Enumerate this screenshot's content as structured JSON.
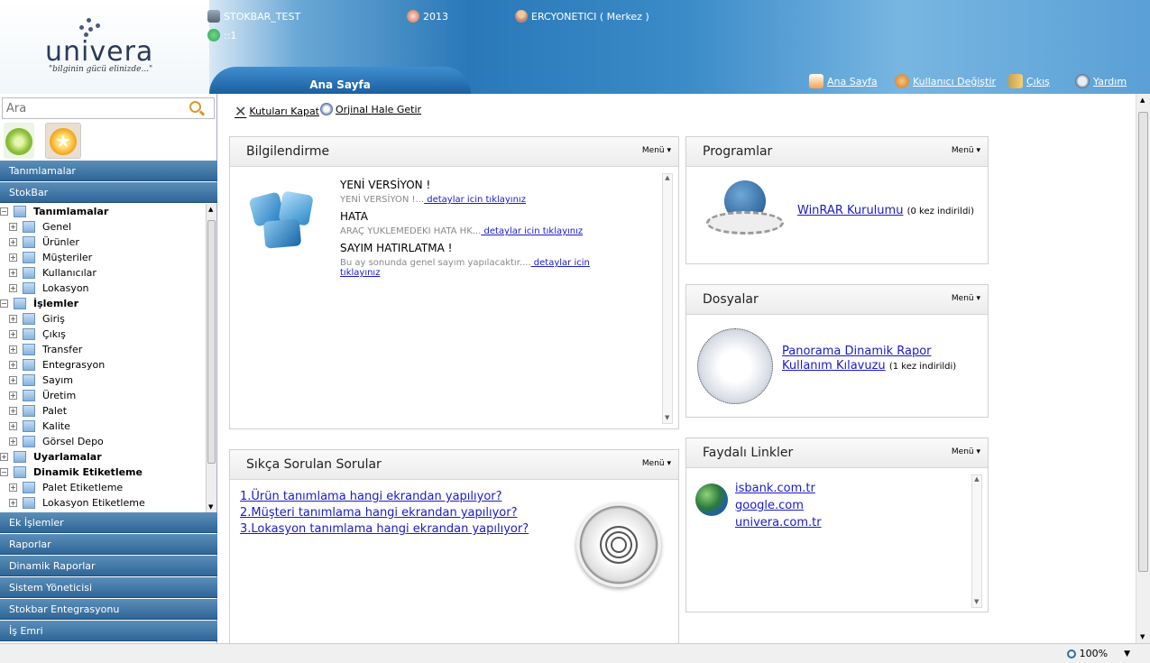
{
  "header": {
    "logo_text": "univera",
    "slogan": "\"bilginin gücü elinizde...\"",
    "db_name": "STOKBAR_TEST",
    "connection": "::1",
    "year": "2013",
    "user": "ERCYONETICI ( Merkez )",
    "home_tab": "Ana Sayfa",
    "links": {
      "home": "Ana Sayfa",
      "switch_user": "Kullanıcı Değiştir",
      "exit": "Çıkış",
      "help": "Yardım"
    }
  },
  "sidebar": {
    "search_placeholder": "Ara",
    "sections_top": [
      "Tanımlamalar",
      "StokBar"
    ],
    "tree": [
      {
        "label": "Tanımlamalar",
        "level": 0,
        "expanded": true,
        "bold": true
      },
      {
        "label": "Genel",
        "level": 1
      },
      {
        "label": "Ürünler",
        "level": 1
      },
      {
        "label": "Müşteriler",
        "level": 1
      },
      {
        "label": "Kullanıcılar",
        "level": 1
      },
      {
        "label": "Lokasyon",
        "level": 1
      },
      {
        "label": "İşlemler",
        "level": 0,
        "expanded": true,
        "bold": true
      },
      {
        "label": "Giriş",
        "level": 1
      },
      {
        "label": "Çıkış",
        "level": 1
      },
      {
        "label": "Transfer",
        "level": 1
      },
      {
        "label": "Entegrasyon",
        "level": 1
      },
      {
        "label": "Sayım",
        "level": 1
      },
      {
        "label": "Üretim",
        "level": 1
      },
      {
        "label": "Palet",
        "level": 1
      },
      {
        "label": "Kalite",
        "level": 1
      },
      {
        "label": "Görsel Depo",
        "level": 1
      },
      {
        "label": "Uyarlamalar",
        "level": 0,
        "expanded": false,
        "bold": true
      },
      {
        "label": "Dinamik Etiketleme",
        "level": 0,
        "expanded": true,
        "bold": true
      },
      {
        "label": "Palet Etiketleme",
        "level": 1
      },
      {
        "label": "Lokasyon Etiketleme",
        "level": 1
      }
    ],
    "sections_bottom": [
      "Ek İşlemler",
      "Raporlar",
      "Dinamik Raporlar",
      "Sistem Yöneticisi",
      "Stokbar Entegrasyonu",
      "İş Emri"
    ]
  },
  "toolbar": {
    "close_boxes": "Kutuları Kapat",
    "restore": "Orjinal Hale Getir"
  },
  "panels": {
    "info": {
      "title": "Bilgilendirme",
      "menu": "Menü",
      "items": [
        {
          "title": "YENİ VERSİYON !",
          "desc": "YENİ VERSİYON !...",
          "link": " detaylar icin tıklayınız"
        },
        {
          "title": "HATA",
          "desc": "ARAÇ YUKLEMEDEKI HATA HK...",
          "link": " detaylar icin tıklayınız"
        },
        {
          "title": "SAYIM HATIRLATMA !",
          "desc": "Bu ay sonunda genel sayım yapılacaktır....",
          "link": " detaylar icin tıklayınız"
        }
      ]
    },
    "programs": {
      "title": "Programlar",
      "menu": "Menü",
      "item_link": "WinRAR Kurulumu",
      "item_count": "(0 kez indirildi)"
    },
    "files": {
      "title": "Dosyalar",
      "menu": "Menü",
      "item_link": "Panorama Dinamik Rapor Kullanım Kılavuzu",
      "item_count": "(1 kez indirildi)"
    },
    "faq": {
      "title": "Sıkça Sorulan Sorular",
      "menu": "Menü",
      "items": [
        "1.Ürün tanımlama hangi ekrandan yapılıyor?",
        "2.Müşteri tanımlama hangi ekrandan yapılıyor?",
        "3.Lokasyon tanımlama hangi ekrandan yapılıyor?"
      ]
    },
    "links": {
      "title": "Faydalı Linkler",
      "menu": "Menü",
      "items": [
        "isbank.com.tr",
        "google.com",
        "univera.com.tr"
      ]
    }
  },
  "status": {
    "zoom": "100%"
  },
  "colors": {
    "accent": "#2f6698",
    "link": "#1a1acc"
  }
}
